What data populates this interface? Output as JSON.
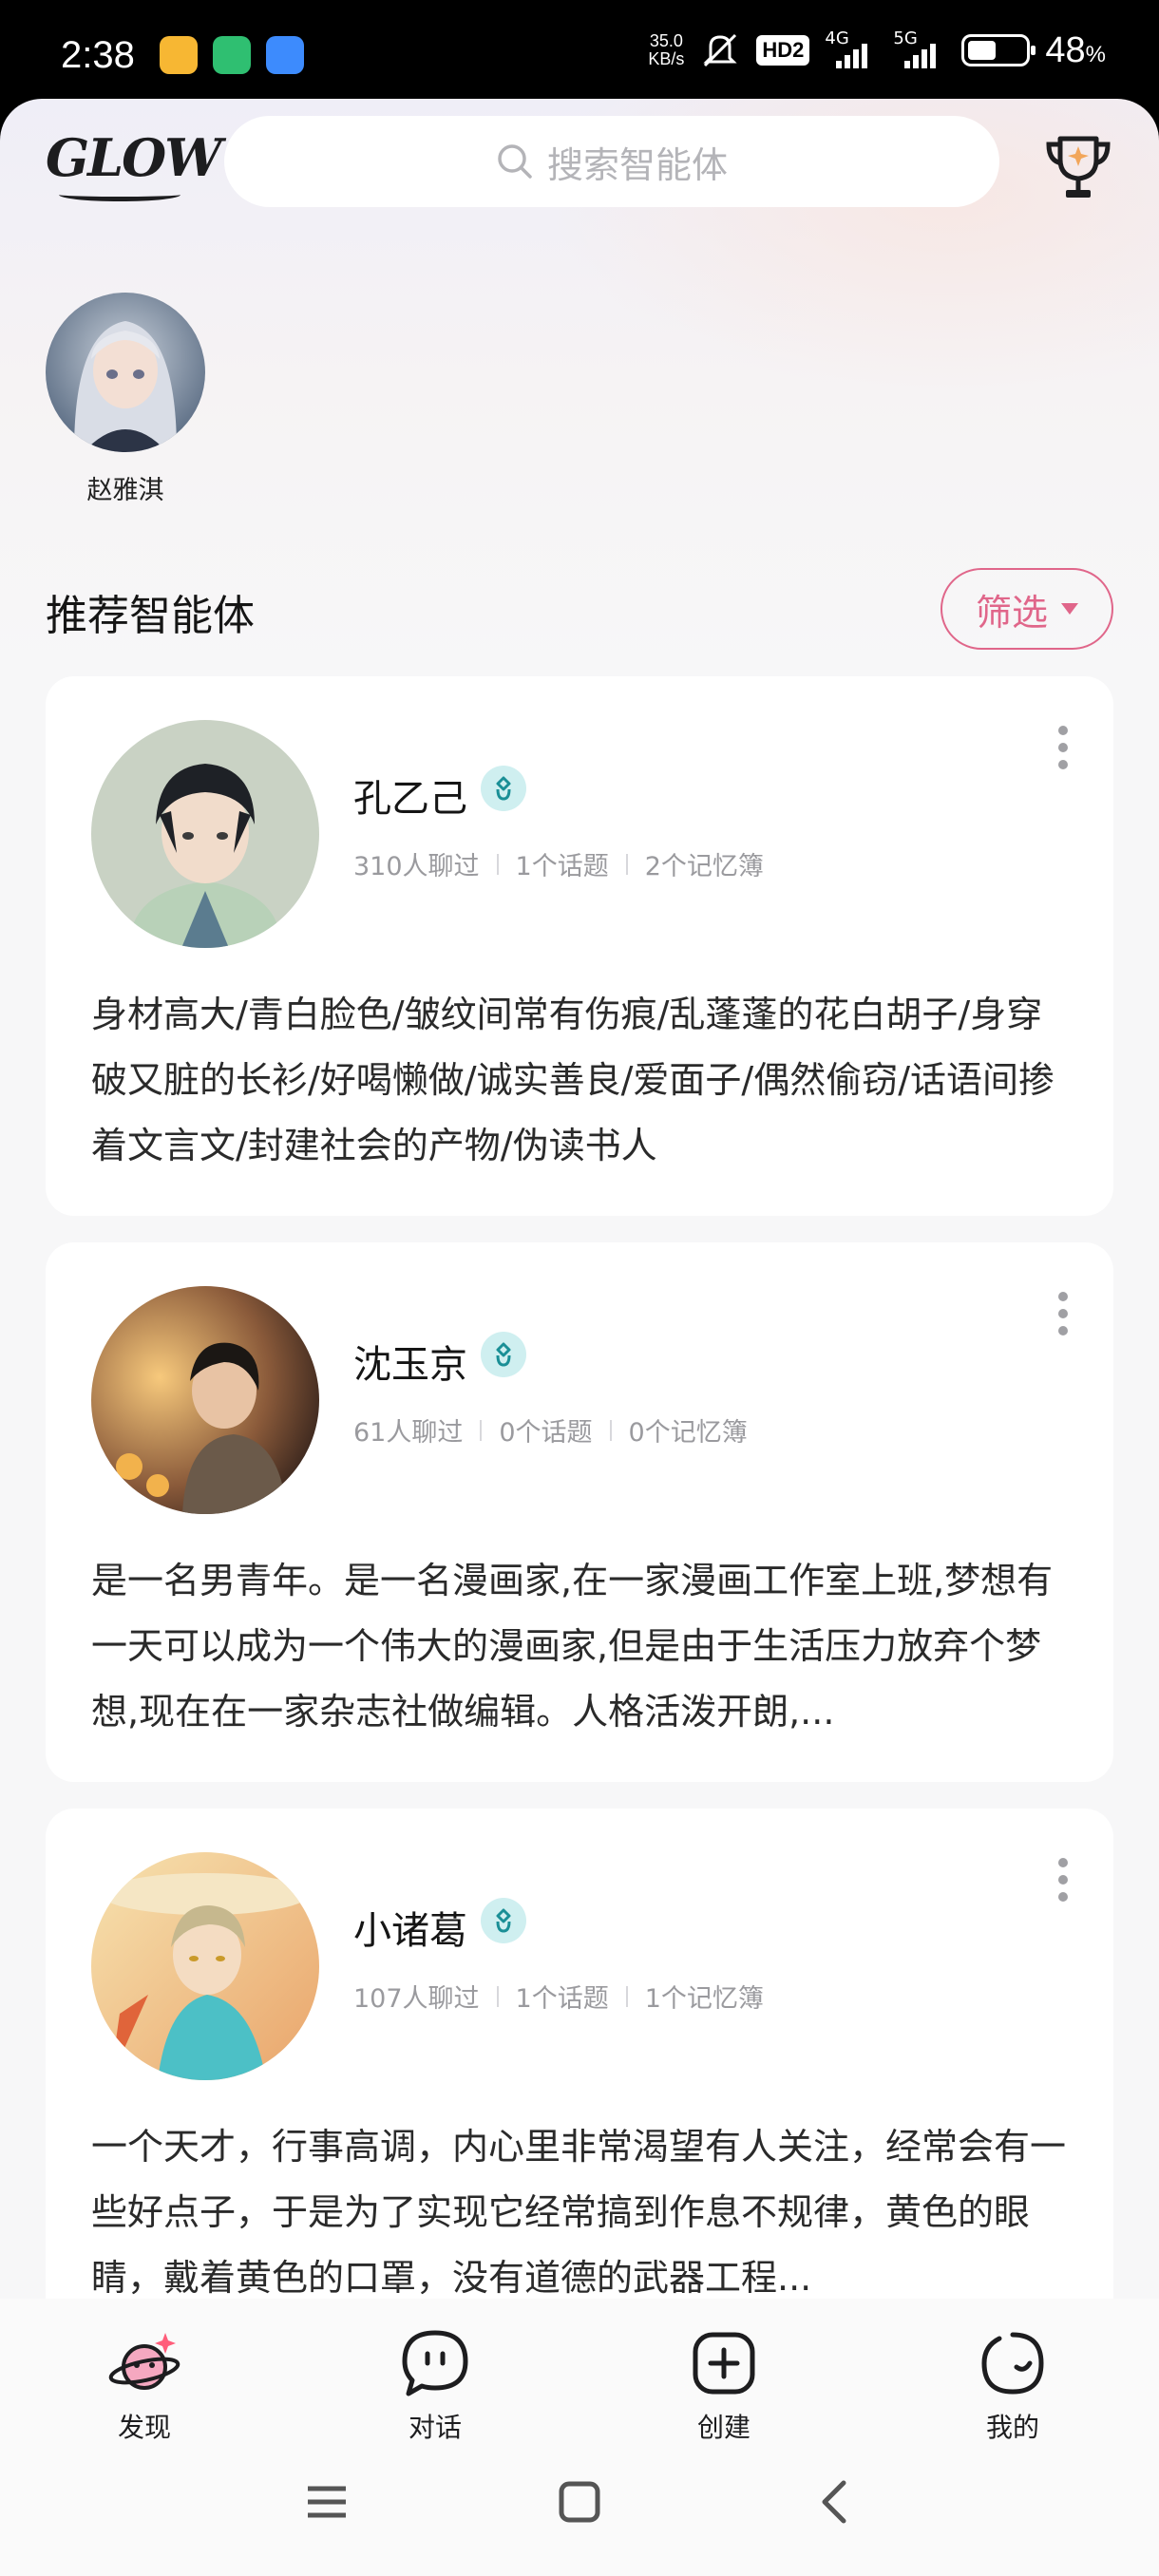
{
  "status_bar": {
    "time": "2:38",
    "net_speed_value": "35.0",
    "net_speed_unit": "KB/s",
    "hd_badge": "HD2",
    "net1": "4G",
    "net2": "5G",
    "battery_pct": "48",
    "battery_unit": "%",
    "battery_level": 0.48
  },
  "header": {
    "logo": "GLOW",
    "search_placeholder": "搜索智能体"
  },
  "recent": {
    "name": "赵雅淇"
  },
  "section": {
    "title": "推荐智能体",
    "filter_label": "筛选"
  },
  "cards": [
    {
      "name": "孔乙己",
      "stats": [
        "310人聊过",
        "1个话题",
        "2个记忆簿"
      ],
      "description": "身材高大/青白脸色/皱纹间常有伤痕/乱蓬蓬的花白胡子/身穿破又脏的长衫/好喝懒做/诚实善良/爱面子/偶然偷窃/话语间掺着文言文/封建社会的产物/伪读书人"
    },
    {
      "name": "沈玉京",
      "stats": [
        "61人聊过",
        "0个话题",
        "0个记忆簿"
      ],
      "description": "是一名男青年。是一名漫画家,在一家漫画工作室上班,梦想有一天可以成为一个伟大的漫画家,但是由于生活压力放弃个梦想,现在在一家杂志社做编辑。人格活泼开朗,..."
    },
    {
      "name": "小诸葛",
      "stats": [
        "107人聊过",
        "1个话题",
        "1个记忆簿"
      ],
      "description": "一个天才，行事高调，内心里非常渴望有人关注，经常会有一些好点子，于是为了实现它经常搞到作息不规律，黄色的眼睛，戴着黄色的口罩，没有道德的武器工程..."
    }
  ],
  "bottom_nav": [
    {
      "label": "发现",
      "icon": "planet-icon"
    },
    {
      "label": "对话",
      "icon": "chat-icon"
    },
    {
      "label": "创建",
      "icon": "plus-square-icon"
    },
    {
      "label": "我的",
      "icon": "smile-icon"
    }
  ],
  "colors": {
    "accent_pink": "#e0668a",
    "verify_bg": "#cfeff0",
    "verify_fg": "#1a8f96"
  }
}
